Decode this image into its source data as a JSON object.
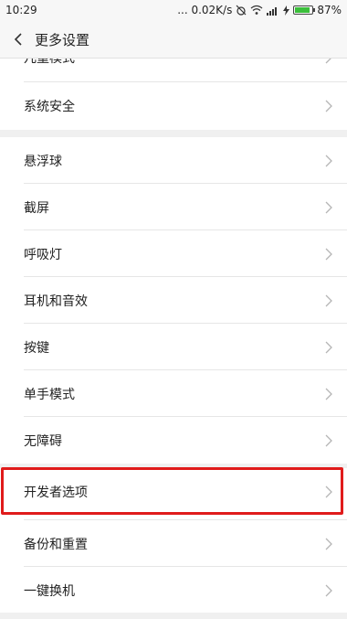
{
  "status_bar": {
    "time": "10:29",
    "network_speed": "... 0.02K/s",
    "battery": "87%",
    "battery_level": 0.87
  },
  "header": {
    "title": "更多设置"
  },
  "items": [
    {
      "label": "儿童模式"
    },
    {
      "label": "系统安全"
    },
    {
      "label": "悬浮球"
    },
    {
      "label": "截屏"
    },
    {
      "label": "呼吸灯"
    },
    {
      "label": "耳机和音效"
    },
    {
      "label": "按键"
    },
    {
      "label": "单手模式"
    },
    {
      "label": "无障碍"
    },
    {
      "label": "开发者选项",
      "highlighted": true
    },
    {
      "label": "备份和重置"
    },
    {
      "label": "一键换机"
    }
  ],
  "colors": {
    "highlight": "#e01b1b",
    "battery": "#3bbf3b"
  }
}
